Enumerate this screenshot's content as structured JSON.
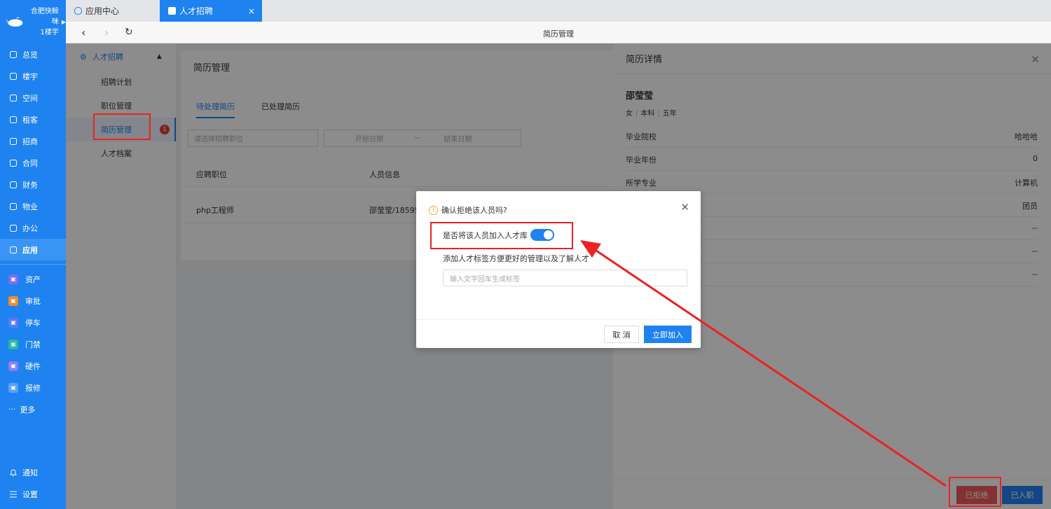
{
  "brand": {
    "name": "合肥快鲸咪",
    "building": "1楼宇"
  },
  "sidebar": {
    "items": [
      {
        "label": "总览",
        "icon": "dashboard-icon"
      },
      {
        "label": "楼宇",
        "icon": "building-icon"
      },
      {
        "label": "空间",
        "icon": "cube-icon"
      },
      {
        "label": "租客",
        "icon": "users-icon"
      },
      {
        "label": "招商",
        "icon": "tag-icon"
      },
      {
        "label": "合同",
        "icon": "document-icon"
      },
      {
        "label": "财务",
        "icon": "yuan-icon"
      },
      {
        "label": "物业",
        "icon": "home-icon"
      },
      {
        "label": "办公",
        "icon": "monitor-icon"
      },
      {
        "label": "应用",
        "icon": "app-icon"
      }
    ],
    "apps": [
      {
        "label": "资产",
        "color": "#7b6cf0"
      },
      {
        "label": "审批",
        "color": "#f08c2b"
      },
      {
        "label": "停车",
        "color": "#5b79f5"
      },
      {
        "label": "门禁",
        "color": "#21c0a0"
      },
      {
        "label": "硬件",
        "color": "#8a7df5"
      },
      {
        "label": "报修",
        "color": "#5aa0f5"
      }
    ],
    "more": "更多",
    "bottom": [
      {
        "label": "通知",
        "icon": "bell-icon"
      },
      {
        "label": "设置",
        "icon": "menu-icon"
      }
    ]
  },
  "tabs": [
    {
      "label": "应用中心"
    },
    {
      "label": "人才招聘"
    }
  ],
  "navbar": {
    "title": "简历管理"
  },
  "submenu": {
    "header": "人才招聘",
    "items": [
      "招聘计划",
      "职位管理",
      "简历管理",
      "人才档案"
    ],
    "badge": "1"
  },
  "main": {
    "title": "简历管理",
    "tabs": [
      "待处理简历",
      "已处理简历"
    ],
    "filter_position": "请选择招聘职位",
    "start_date": "开始日期",
    "date_sep": "~",
    "end_date": "结束日期",
    "columns": [
      "应聘职位",
      "人员信息"
    ],
    "rows": [
      {
        "position": "php工程师",
        "info": "邵莹莹/18595"
      }
    ]
  },
  "drawer": {
    "title": "简历详情",
    "name": "邵莹莹",
    "gender": "女",
    "education": "本科",
    "experience": "五年",
    "fields": [
      {
        "label": "毕业院校",
        "value": "哈哈哈"
      },
      {
        "label": "毕业年份",
        "value": "0"
      },
      {
        "label": "所学专业",
        "value": "计算机"
      },
      {
        "label": "",
        "value": "团员"
      },
      {
        "label": "",
        "value": "--"
      },
      {
        "label": "",
        "value": "--"
      },
      {
        "label": "",
        "value": "--"
      }
    ],
    "reject_label": "已拒绝",
    "hired_label": "已入职"
  },
  "modal": {
    "title": "确认拒绝该人员吗?",
    "question": "是否将该人员加入人才库",
    "toggle_on": true,
    "hint": "添加人才标签方便更好的管理以及了解人才",
    "input_placeholder": "输入文字回车生成标签",
    "cancel": "取 消",
    "confirm": "立即加入"
  },
  "colors": {
    "primary": "#1e82f0",
    "danger": "#ef5a5a",
    "annotation": "#e92222"
  }
}
